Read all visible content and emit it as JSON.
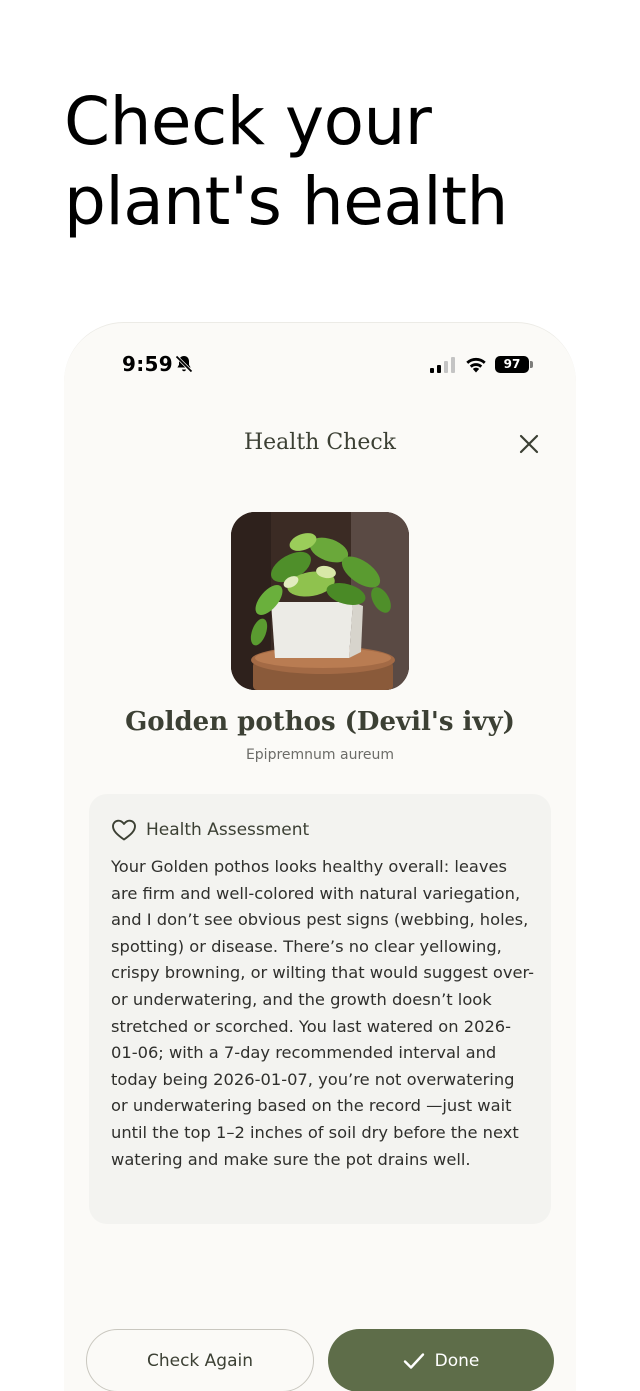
{
  "promo": {
    "headline_line1": "Check your",
    "headline_line2": "plant's health"
  },
  "status_bar": {
    "time": "9:59",
    "battery": "97",
    "icons": [
      "bell-slash-icon",
      "cellular-signal-icon",
      "wifi-icon",
      "battery-icon"
    ]
  },
  "header": {
    "title": "Health Check",
    "close_icon": "close-icon"
  },
  "plant": {
    "common_name": "Golden pothos (Devil's ivy)",
    "scientific_name": "Epipremnum aureum",
    "photo": "plant-photo"
  },
  "assessment": {
    "title": "Health Assessment",
    "icon": "heart-icon",
    "body": "Your Golden pothos looks healthy overall: leaves are firm and well-colored with natural variegation, and I don’t see obvious pest signs (webbing, holes, spotting) or disease. There’s no clear yellowing, crispy browning, or wilting that would suggest over- or underwatering, and the growth doesn’t look stretched or scorched. You last watered on 2026-01-06; with a 7-day recommended interval and today being 2026-01-07, you’re not overwatering or underwatering based on the record —just wait until the top 1–2 inches of soil dry before the next watering and make sure the pot drains well."
  },
  "actions": {
    "check_again_label": "Check Again",
    "done_label": "Done",
    "done_icon": "checkmark-icon"
  },
  "colors": {
    "accent": "#5e6d49",
    "card_bg": "#f3f3f0",
    "screen_bg": "#fbfaf7",
    "text_dark": "#3c4034"
  }
}
